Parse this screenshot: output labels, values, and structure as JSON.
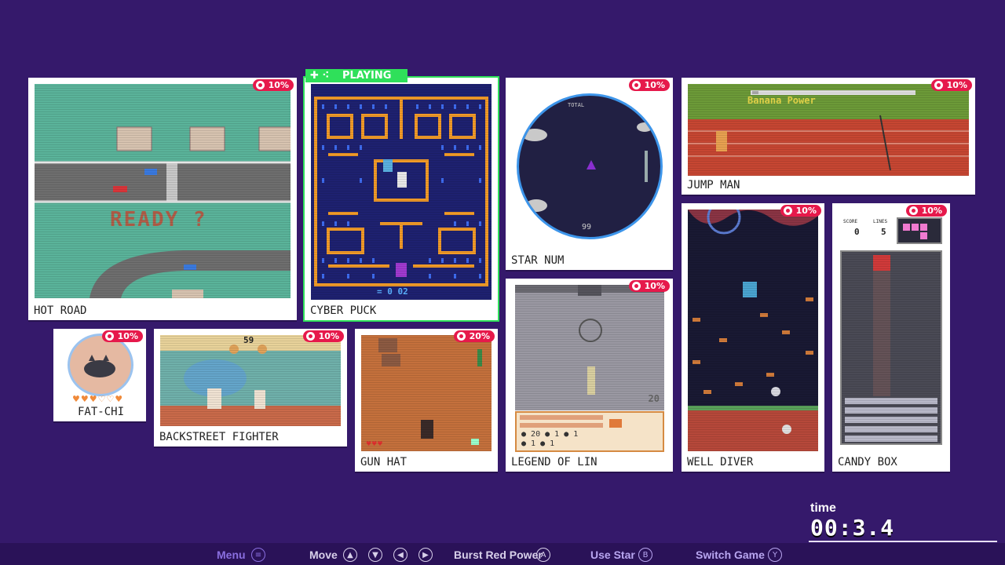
{
  "status": {
    "playing": "PLAYING",
    "time_label": "time",
    "time_value": "00:3.4"
  },
  "games": [
    {
      "title": "HOT ROAD",
      "pct": "10%",
      "overlay": "READY ?"
    },
    {
      "title": "CYBER PUCK",
      "pct": "",
      "hud": "= 0  02"
    },
    {
      "title": "STAR NUM",
      "pct": "10%",
      "hud_top": "TOTAL",
      "hud_bottom": "99"
    },
    {
      "title": "JUMP MAN",
      "pct": "10%",
      "banner": "Banana Power"
    },
    {
      "title": "FAT-CHI",
      "pct": "10%"
    },
    {
      "title": "BACKSTREET FIGHTER",
      "pct": "10%",
      "hud": "59"
    },
    {
      "title": "GUN HAT",
      "pct": "20%"
    },
    {
      "title": "LEGEND OF LIN",
      "pct": "10%",
      "stats": [
        "20",
        "1",
        "1",
        "1",
        "1"
      ],
      "hud": "20"
    },
    {
      "title": "WELL DIVER",
      "pct": "10%"
    },
    {
      "title": "CANDY BOX",
      "pct": "10%",
      "score_label": "SCORE",
      "score": "0",
      "lines_label": "LINES",
      "lines": "5"
    }
  ],
  "controls": [
    {
      "label": "Menu",
      "icon": "≡",
      "color": "#8a6fe0"
    },
    {
      "label": "Move",
      "icon": "arrows",
      "color": "#d8d0ea"
    },
    {
      "label": "Burst Red Power",
      "icon": "A",
      "color": "#d8d0ea"
    },
    {
      "label": "Use Star",
      "icon": "B",
      "color": "#b8a6f0"
    },
    {
      "label": "Switch Game",
      "icon": "Y",
      "color": "#b8a6f0"
    }
  ],
  "colors": {
    "background": "#35196b",
    "accent_red": "#e6194b",
    "playing_green": "#2fe05a"
  }
}
